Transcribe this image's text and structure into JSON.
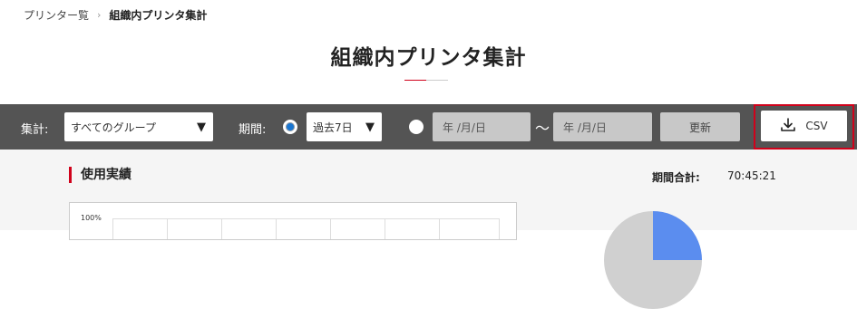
{
  "breadcrumb": {
    "parent": "プリンター覧",
    "separator": "›",
    "current": "組織内プリンタ集計"
  },
  "page_title": "組織内プリンタ集計",
  "toolbar": {
    "aggregate_label": "集計:",
    "group_select": {
      "value": "すべてのグループ",
      "caret": "▼"
    },
    "period_label": "期間:",
    "period_select": {
      "value": "過去7日",
      "caret": "▼"
    },
    "date_from_placeholder": "年 /月/日",
    "range_separator": "〜",
    "date_to_placeholder": "年 /月/日",
    "update_label": "更新",
    "csv_label": "CSV",
    "preset_radio_selected": true
  },
  "usage": {
    "section_title": "使用実績",
    "total_label": "期間合計:",
    "total_value": "70:45:21",
    "chart_y_top_tick": "100%"
  },
  "colors": {
    "accent_red": "#d0021b",
    "radio_blue": "#1976d2",
    "toolbar_bg": "#545454",
    "pie_blue": "#5b8def",
    "pie_gray": "#d0d0d0"
  },
  "icons": {
    "download": "download-icon",
    "caret": "chevron-down-icon"
  }
}
